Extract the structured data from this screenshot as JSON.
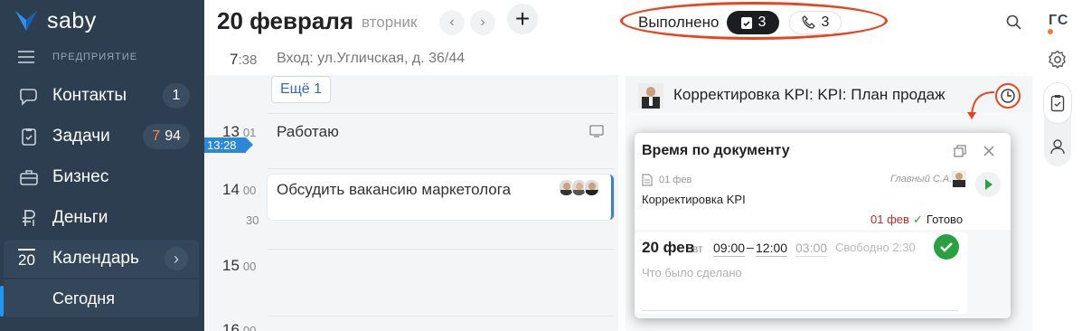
{
  "app": {
    "name": "saby",
    "section": "ПРЕДПРИЯТИЕ"
  },
  "sidebar": {
    "items": [
      {
        "label": "Контакты",
        "icon": "chat-icon",
        "badge": "1"
      },
      {
        "label": "Задачи",
        "icon": "task-icon",
        "badge_accent": "7",
        "badge": "94"
      },
      {
        "label": "Бизнес",
        "icon": "briefcase-icon"
      },
      {
        "label": "Деньги",
        "icon": "ruble-icon"
      },
      {
        "label": "Календарь",
        "icon": "calendar-icon",
        "day": "20"
      },
      {
        "label": "Сегодня"
      }
    ]
  },
  "header": {
    "date": "20 февраля",
    "weekday": "вторник",
    "prev": "‹",
    "next": "›",
    "add": "+",
    "done_label": "Выполнено",
    "done_tasks": "3",
    "done_calls": "3",
    "user_initials": "ГС"
  },
  "schedule": {
    "entry_hour": "7",
    "entry_min": ":38",
    "entry_text": "Вход: ул.Угличская, д. 36/44",
    "more": "Ещё 1",
    "now": "13:28",
    "hours": [
      {
        "h": "13",
        "m": "01"
      },
      {
        "h": "14",
        "m": "00"
      },
      {
        "h": "15",
        "m": "00"
      },
      {
        "h": "16",
        "m": "00"
      }
    ],
    "half": "30",
    "event_working": "Работаю",
    "event_meeting": "Обсудить вакансию маркетолога"
  },
  "document": {
    "title": "Корректировка KPI: KPI: План продаж",
    "popup_title": "Время по документу",
    "doc_date": "01 фев",
    "doc_name": "Корректировка KPI",
    "author": "Главный С.А.",
    "due": "01 фев",
    "status": "Готово",
    "day": "20 фев",
    "day_short": "вт",
    "start": "09:00",
    "end": "12:00",
    "duration": "03:00",
    "free": "Свободно 2:30",
    "done_placeholder": "Что было сделано"
  },
  "colors": {
    "sidebar": "#2c3e50",
    "accent_red": "#e8451f",
    "accent_blue": "#2b88d8",
    "green": "#2aa13f"
  }
}
